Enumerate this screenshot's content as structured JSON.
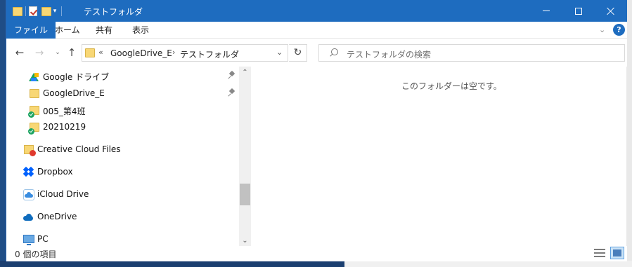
{
  "window": {
    "title": "テストフォルダ",
    "controls": {
      "minimize_icon": "minimize-icon",
      "maximize_icon": "maximize-icon",
      "close_icon": "close-icon"
    }
  },
  "ribbon": {
    "tabs": [
      "ファイル",
      "ホーム",
      "共有",
      "表示"
    ],
    "help": "?"
  },
  "address": {
    "segments": [
      "GoogleDrive_E",
      "テストフォルダ"
    ],
    "overflow": "«",
    "separator": "›"
  },
  "search": {
    "placeholder": "テストフォルダの検索"
  },
  "navpane": {
    "items": [
      {
        "label": "Google ドライブ",
        "icon": "google-drive-icon",
        "pinned": true
      },
      {
        "label": "GoogleDrive_E",
        "icon": "folder-icon",
        "pinned": true
      },
      {
        "label": "005_第4班",
        "icon": "folder-icon",
        "synced": true
      },
      {
        "label": "20210219",
        "icon": "folder-icon",
        "synced": true
      },
      {
        "label": "Creative Cloud Files",
        "icon": "creative-cloud-folder-icon"
      },
      {
        "label": "Dropbox",
        "icon": "dropbox-icon"
      },
      {
        "label": "iCloud Drive",
        "icon": "icloud-icon"
      },
      {
        "label": "OneDrive",
        "icon": "onedrive-icon"
      },
      {
        "label": "PC",
        "icon": "pc-icon"
      }
    ]
  },
  "content": {
    "empty_message": "このフォルダーは空です。"
  },
  "statusbar": {
    "item_count": "0 個の項目"
  },
  "colors": {
    "titlebar": "#1e6cbf",
    "accent": "#1e6cbf"
  }
}
